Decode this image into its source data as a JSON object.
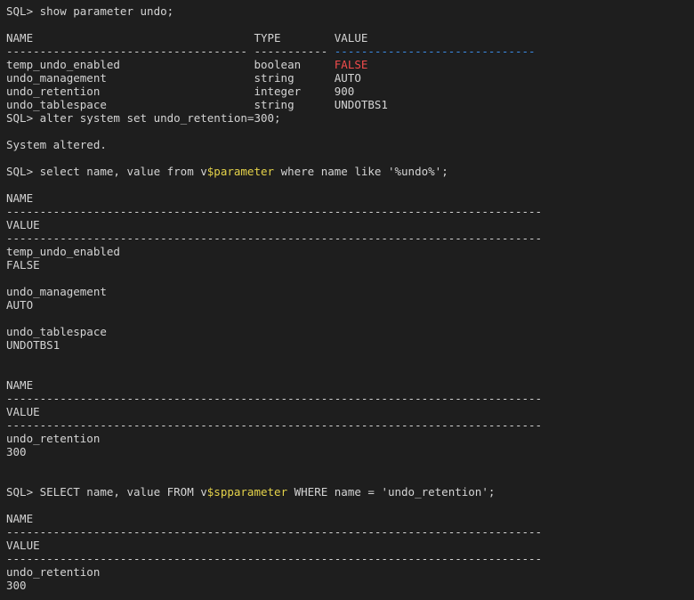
{
  "terminal": {
    "lines": [
      [
        {
          "t": "SQL> show parameter undo;"
        }
      ],
      [
        {
          "t": ""
        }
      ],
      [
        {
          "t": "NAME                                 TYPE        VALUE"
        }
      ],
      [
        {
          "t": "------------------------------------ ----------- "
        },
        {
          "t": "------------------------------",
          "c": "blue"
        }
      ],
      [
        {
          "t": "temp_undo_enabled                    boolean     "
        },
        {
          "t": "FALSE",
          "c": "red"
        }
      ],
      [
        {
          "t": "undo_management                      string      AUTO"
        }
      ],
      [
        {
          "t": "undo_retention                       integer     900"
        }
      ],
      [
        {
          "t": "undo_tablespace                      string      UNDOTBS1"
        }
      ],
      [
        {
          "t": "SQL> alter system set undo_retention=300;"
        }
      ],
      [
        {
          "t": ""
        }
      ],
      [
        {
          "t": "System altered."
        }
      ],
      [
        {
          "t": ""
        }
      ],
      [
        {
          "t": "SQL> select name, value from v"
        },
        {
          "t": "$parameter",
          "c": "yellow"
        },
        {
          "t": " where name like '%undo%';"
        }
      ],
      [
        {
          "t": ""
        }
      ],
      [
        {
          "t": "NAME"
        }
      ],
      [
        {
          "t": "--------------------------------------------------------------------------------"
        }
      ],
      [
        {
          "t": "VALUE"
        }
      ],
      [
        {
          "t": "--------------------------------------------------------------------------------"
        }
      ],
      [
        {
          "t": "temp_undo_enabled"
        }
      ],
      [
        {
          "t": "FALSE"
        }
      ],
      [
        {
          "t": ""
        }
      ],
      [
        {
          "t": "undo_management"
        }
      ],
      [
        {
          "t": "AUTO"
        }
      ],
      [
        {
          "t": ""
        }
      ],
      [
        {
          "t": "undo_tablespace"
        }
      ],
      [
        {
          "t": "UNDOTBS1"
        }
      ],
      [
        {
          "t": ""
        }
      ],
      [
        {
          "t": ""
        }
      ],
      [
        {
          "t": "NAME"
        }
      ],
      [
        {
          "t": "--------------------------------------------------------------------------------"
        }
      ],
      [
        {
          "t": "VALUE"
        }
      ],
      [
        {
          "t": "--------------------------------------------------------------------------------"
        }
      ],
      [
        {
          "t": "undo_retention"
        }
      ],
      [
        {
          "t": "300"
        }
      ],
      [
        {
          "t": ""
        }
      ],
      [
        {
          "t": ""
        }
      ],
      [
        {
          "t": "SQL> SELECT name, value FROM v"
        },
        {
          "t": "$spparameter",
          "c": "yellow"
        },
        {
          "t": " WHERE name = 'undo_retention';"
        }
      ],
      [
        {
          "t": ""
        }
      ],
      [
        {
          "t": "NAME"
        }
      ],
      [
        {
          "t": "--------------------------------------------------------------------------------"
        }
      ],
      [
        {
          "t": "VALUE"
        }
      ],
      [
        {
          "t": "--------------------------------------------------------------------------------"
        }
      ],
      [
        {
          "t": "undo_retention"
        }
      ],
      [
        {
          "t": "300"
        }
      ]
    ]
  },
  "colors": {
    "background": "#1e1e1e",
    "text": "#d4d4d4",
    "yellow": "#e5d34a",
    "red": "#f14c4c",
    "blue": "#3b8eea"
  }
}
